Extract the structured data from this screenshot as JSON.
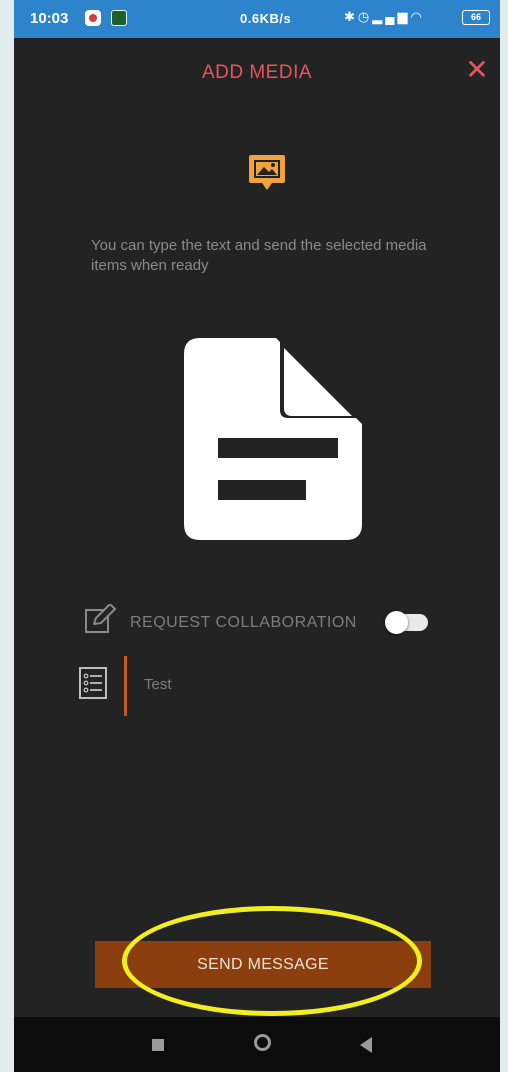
{
  "status_bar": {
    "time": "10:03",
    "network_speed": "0.6KB/s",
    "icons": [
      "bluetooth-icon",
      "alarm-icon",
      "signal-icon",
      "vowifi-icon",
      "signal-icon",
      "vowifi-icon",
      "wifi-icon"
    ],
    "battery": "66"
  },
  "header": {
    "title": "ADD MEDIA",
    "close_icon": "close-icon"
  },
  "description": "You can type the text and send the selected media items when ready",
  "request_collaboration": {
    "label": "REQUEST COLLABORATION",
    "enabled": false
  },
  "message": {
    "value": "Test"
  },
  "send_button": {
    "label": "SEND MESSAGE"
  },
  "colors": {
    "accent_red": "#e8545c",
    "icon_orange": "#f1a23a",
    "button_brown": "#8b3f0f",
    "highlight_yellow": "#f2ee1f",
    "background": "#232323",
    "status_bar": "#2e84cc"
  }
}
